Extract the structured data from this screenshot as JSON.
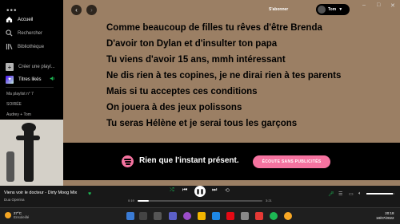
{
  "sidebar": {
    "nav": [
      {
        "label": "Accueil",
        "icon": "home-icon"
      },
      {
        "label": "Rechercher",
        "icon": "search-icon"
      },
      {
        "label": "Bibliothèque",
        "icon": "library-icon"
      }
    ],
    "create_playlist": "Créer une playl...",
    "liked_songs": "Titres likés",
    "playlists": [
      "Ma playlist n° 7",
      "SOIRÉE",
      "Audrey + Tom"
    ]
  },
  "header": {
    "subscribe": "S'abonner",
    "user_name": "Tom"
  },
  "lyrics": [
    "Comme beaucoup de filles tu rêves d'être Brenda",
    "D'avoir ton Dylan et d'insulter ton papa",
    "Tu viens d'avoir 15 ans, mmh intéressant",
    "Ne dis rien à tes copines, je ne dirai rien à tes parents",
    "Mais si tu acceptes ces conditions",
    "On jouera à des jeux polissons",
    "Tu seras Hélène et je serai tous les garçons"
  ],
  "banner": {
    "text": "Rien que l'instant présent.",
    "button": "ÉCOUTE SANS PUBLICITÉS"
  },
  "player": {
    "track": "Viens voir le docteur - Dirty Moog Mix",
    "artist": "Dua Operina",
    "elapsed": "0:19",
    "duration": "3:21",
    "progress": 0.09,
    "volume": 0.95
  },
  "taskbar": {
    "temperature": "27°C",
    "weather": "Ensoleillé",
    "time": "20:18",
    "date": "18/07/2022"
  },
  "colors": {
    "background": "#9b7f64",
    "accent_pink": "#f573a0",
    "spotify_green": "#1db954"
  }
}
